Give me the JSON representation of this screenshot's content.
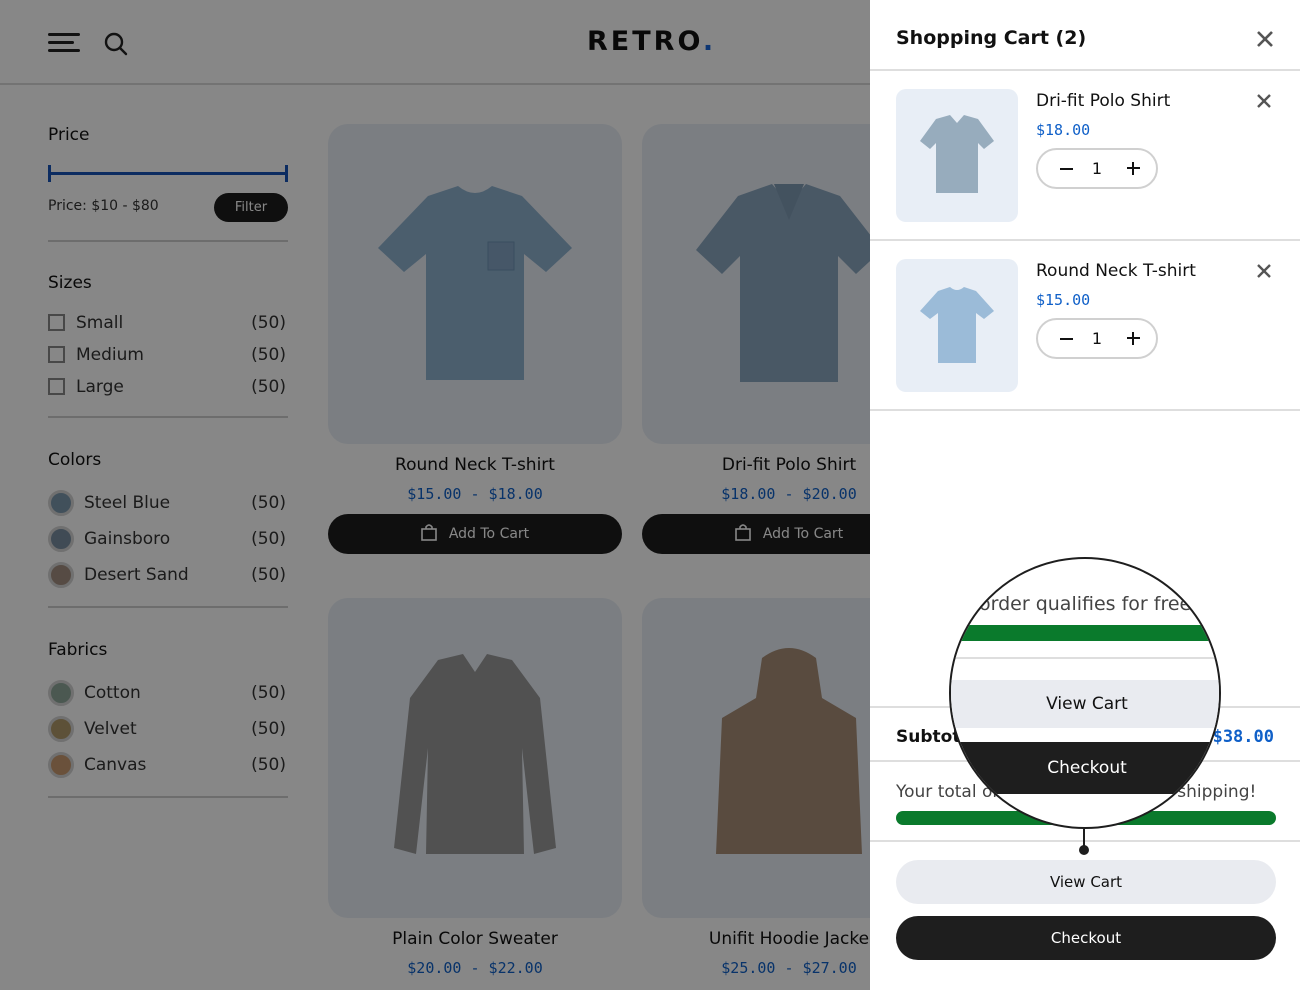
{
  "header": {
    "logo": "RETRO",
    "logo_dot": "."
  },
  "sidebar": {
    "price": {
      "title": "Price",
      "range_label": "Price: $10 - $80",
      "filter_button": "Filter"
    },
    "sizes": {
      "title": "Sizes",
      "items": [
        {
          "label": "Small",
          "count": "(50)"
        },
        {
          "label": "Medium",
          "count": "(50)"
        },
        {
          "label": "Large",
          "count": "(50)"
        }
      ]
    },
    "colors": {
      "title": "Colors",
      "items": [
        {
          "label": "Steel Blue",
          "count": "(50)",
          "color": "#7c97ad"
        },
        {
          "label": "Gainsboro",
          "count": "(50)",
          "color": "#7a8fa0"
        },
        {
          "label": "Desert Sand",
          "count": "(50)",
          "color": "#a28f80"
        }
      ]
    },
    "fabrics": {
      "title": "Fabrics",
      "items": [
        {
          "label": "Cotton",
          "count": "(50)",
          "color": "#8ea79a"
        },
        {
          "label": "Velvet",
          "count": "(50)",
          "color": "#b09a6a"
        },
        {
          "label": "Canvas",
          "count": "(50)",
          "color": "#c89a70"
        }
      ]
    }
  },
  "products": [
    {
      "name": "Round Neck T-shirt",
      "price": "$15.00 - $18.00",
      "button": "Add To Cart"
    },
    {
      "name": "Dri-fit Polo Shirt",
      "price": "$18.00 - $20.00",
      "button": "Add To Cart"
    },
    {
      "name": "Plain Color Sweater",
      "price": "$20.00 - $22.00"
    },
    {
      "name": "Unifit Hoodie Jacke",
      "price": "$25.00 - $27.00"
    }
  ],
  "cart": {
    "title": "Shopping Cart (2)",
    "items": [
      {
        "name": "Dri-fit Polo Shirt",
        "price": "$18.00",
        "qty": "1"
      },
      {
        "name": "Round Neck T-shirt",
        "price": "$15.00",
        "qty": "1"
      }
    ],
    "subtotal_label": "Subtotal:",
    "subtotal_value": "$38.00",
    "shipping_text": "Your total order qualifies for free shipping!",
    "free_shipping_progress": 1.0,
    "view_cart": "View Cart",
    "checkout": "Checkout"
  },
  "magnifier": {
    "text": "order qualifies for free",
    "view_cart": "View Cart",
    "checkout": "Checkout"
  },
  "colors": {
    "accent_blue": "#1060c8",
    "success_green": "#0a7a2c",
    "dark": "#1e1e1e"
  }
}
